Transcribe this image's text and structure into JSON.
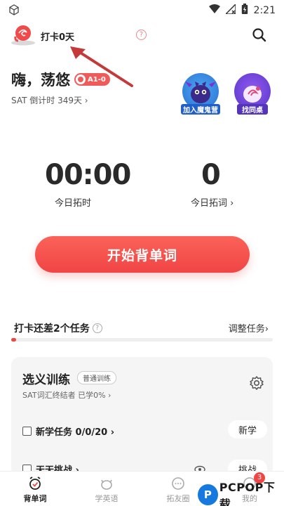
{
  "status_bar": {
    "time": "2:21",
    "icons": [
      "cube-icon",
      "wifi-icon",
      "no-signal-icon",
      "battery-icon"
    ]
  },
  "header": {
    "checkin_text": "打卡0天",
    "help_glyph": "?"
  },
  "greeting": {
    "text": "嗨，荡悠",
    "level": "A1-0",
    "countdown": "SAT 倒计时 349天 ›"
  },
  "badges": [
    {
      "label": "加入魔鬼营"
    },
    {
      "label": "找同桌"
    }
  ],
  "stats": {
    "time_value": "00:00",
    "time_label": "今日拓时",
    "words_value": "0",
    "words_label": "今日拓词 ›"
  },
  "start_button": "开始背单词",
  "tasks": {
    "title": "打卡还差2个任务",
    "help_glyph": "?",
    "adjust": "调整任务›",
    "progress": 0.02
  },
  "card": {
    "title": "选义训练",
    "mode": "普通训练",
    "subtitle": "SAT词汇终结者   已学0% ›",
    "row1": {
      "label": "新学任务 0/0/20 ›",
      "button": "新学"
    },
    "row2": {
      "label": "天天挑战 ›",
      "button": "挑战"
    }
  },
  "tabbar": [
    {
      "label": "背单词",
      "active": true
    },
    {
      "label": "学英语",
      "active": false
    },
    {
      "label": "拓友圈",
      "active": false
    },
    {
      "label": "我的",
      "active": false
    }
  ],
  "notification_count": "3",
  "watermark": {
    "logo": "P",
    "text": "PCPOP下载"
  },
  "colors": {
    "accent": "#f04545",
    "badge_blue": "#2b6fd3",
    "badge_purple": "#5b35c9"
  }
}
